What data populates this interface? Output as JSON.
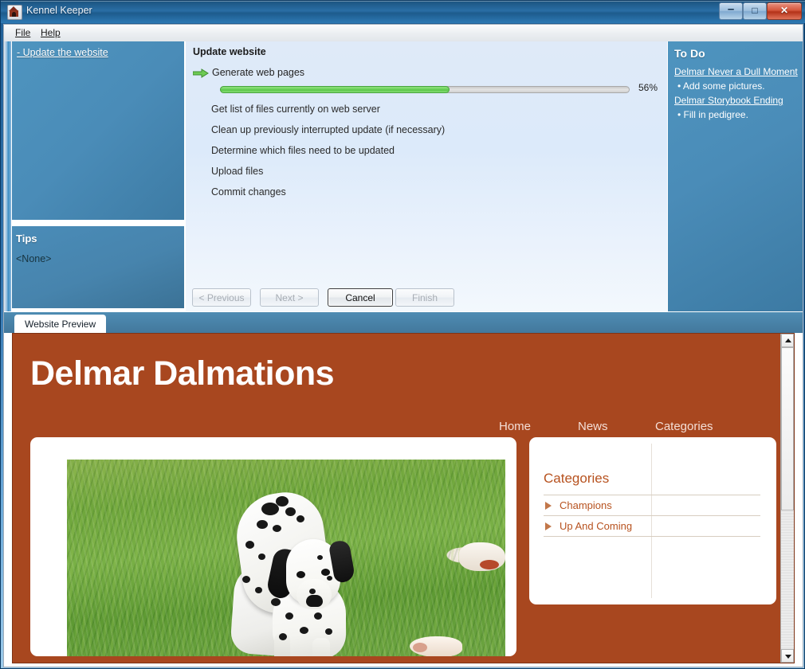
{
  "window": {
    "title": "Kennel Keeper",
    "icon": "kennel-icon",
    "minimize_glyph": "–",
    "maximize_glyph": "□",
    "close_glyph": "✕"
  },
  "menubar": {
    "items": [
      {
        "label": "File",
        "accel": "F"
      },
      {
        "label": "Help",
        "accel": "H"
      }
    ]
  },
  "sidebar": {
    "tasks": {
      "link": "- Update the website"
    },
    "tips": {
      "title": "Tips",
      "value": "<None>"
    }
  },
  "wizard": {
    "title": "Update website",
    "current_step": "Generate web pages",
    "progress_percent": 56,
    "progress_label": "56%",
    "steps": [
      "Get list of files currently on web server",
      "Clean up previously interrupted update (if necessary)",
      "Determine which files need to be updated",
      "Upload files",
      "Commit changes"
    ],
    "buttons": {
      "previous": "< Previous",
      "next": "Next >",
      "cancel": "Cancel",
      "finish": "Finish"
    }
  },
  "todo": {
    "title": "To Do",
    "entries": [
      {
        "link": "Delmar Never a Dull Moment",
        "item": "• Add some pictures."
      },
      {
        "link": "Delmar Storybook Ending",
        "item": "• Fill in pedigree."
      }
    ]
  },
  "tabs": [
    {
      "label": "Website Preview",
      "selected": true
    }
  ],
  "preview": {
    "site_title": "Delmar Dalmations",
    "nav": [
      "Home",
      "News",
      "Categories"
    ],
    "photo_alt": "dalmatian-on-grass-photo",
    "categories": {
      "heading": "Categories",
      "rows": [
        "Champions",
        "Up And Coming"
      ]
    }
  },
  "colors": {
    "title_bar": "#2a6ea5",
    "sidebar_blue": "#4a8cb8",
    "wizard_blue": "#dceafa",
    "brand_rust": "#a8471f",
    "brand_text": "#b7521f",
    "progress_green": "#6ed35c"
  }
}
